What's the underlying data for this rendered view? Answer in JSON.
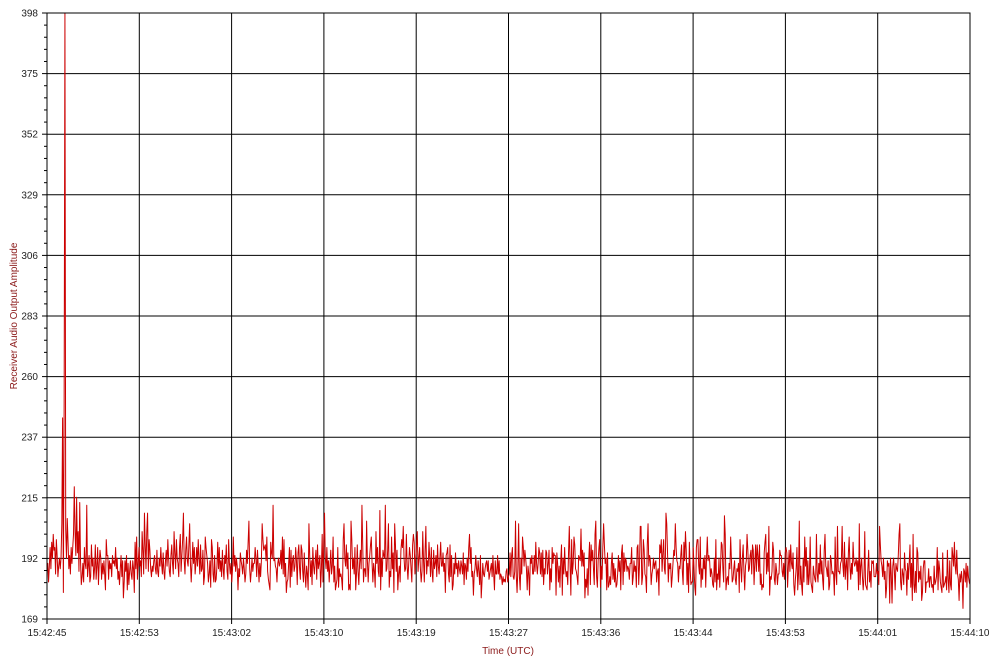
{
  "chart_data": {
    "type": "line",
    "title": "",
    "xlabel": "Time (UTC)",
    "ylabel": "Receiver Audio Output Amplitude",
    "ylim": [
      169,
      398
    ],
    "yticks": [
      398,
      375,
      352,
      329,
      306,
      283,
      260,
      237,
      215,
      192,
      169
    ],
    "xticks": [
      "15:42:45",
      "15:42:53",
      "15:43:02",
      "15:43:10",
      "15:43:19",
      "15:43:27",
      "15:43:36",
      "15:43:44",
      "15:43:53",
      "15:44:01",
      "15:44:10"
    ],
    "grid": true,
    "line_color": "#cc0000",
    "grid_color": "#000000",
    "x_time_start": "15:42:45",
    "x_time_end": "15:44:10",
    "series": [
      {
        "values": [
          187,
          190,
          183,
          189,
          196,
          188,
          198,
          192,
          201,
          195,
          196,
          186,
          199,
          193,
          185,
          189,
          192,
          188,
          192,
          205,
          245,
          179,
          251,
          398,
          203,
          192,
          207,
          198,
          188,
          193,
          186,
          196,
          190,
          196,
          201,
          219,
          202,
          193,
          215,
          194,
          202,
          187,
          213,
          191,
          182,
          185,
          190,
          183,
          196,
          190,
          188,
          212,
          185,
          189,
          193,
          183,
          185,
          197,
          189,
          192,
          184,
          188,
          197,
          184,
          189,
          196,
          182,
          190,
          195,
          192,
          184,
          190,
          186,
          191,
          186,
          180,
          199,
          193,
          193,
          184,
          191,
          188,
          190,
          185,
          193,
          190,
          191,
          189,
          196,
          188,
          192,
          184,
          187,
          182,
          188,
          193,
          185,
          191,
          177,
          183,
          191,
          187,
          193,
          180,
          190,
          182,
          187,
          191,
          186,
          184,
          191,
          188,
          179,
          198,
          188,
          200,
          184,
          190,
          196,
          189,
          191,
          185,
          202,
          195,
          186,
          209,
          197,
          188,
          202,
          209,
          187,
          199,
          195,
          188,
          185,
          189,
          187,
          191,
          193,
          188,
          186,
          195,
          187,
          185,
          192,
          189,
          196,
          190,
          186,
          194,
          187,
          184,
          191,
          195,
          189,
          199,
          192,
          187,
          185,
          193,
          197,
          190,
          186,
          202,
          194,
          188,
          199,
          192,
          190,
          185,
          196,
          201,
          187,
          193,
          199,
          209,
          191,
          186,
          195,
          200,
          191,
          189,
          197,
          205,
          190,
          183,
          190,
          198,
          190,
          196,
          186,
          190,
          196,
          189,
          199,
          192,
          186,
          197,
          187,
          188,
          195,
          182,
          185,
          200,
          196,
          193,
          190,
          183,
          186,
          191,
          181,
          199,
          196,
          186,
          183,
          193,
          183,
          184,
          189,
          198,
          188,
          196,
          187,
          191,
          185,
          195,
          188,
          184,
          193,
          190,
          197,
          187,
          184,
          199,
          190,
          186,
          190,
          183,
          188,
          200,
          189,
          193,
          187,
          192,
          189,
          180,
          188,
          185,
          194,
          191,
          189,
          186,
          192,
          188,
          183,
          186,
          195,
          190,
          198,
          206,
          188,
          183,
          187,
          192,
          187,
          190,
          190,
          196,
          192,
          185,
          195,
          189,
          183,
          190,
          185,
          191,
          205,
          199,
          195,
          196,
          197,
          191,
          200,
          187,
          184,
          182,
          180,
          198,
          194,
          192,
          212,
          191,
          192,
          189,
          188,
          183,
          190,
          192,
          189,
          190,
          195,
          188,
          200,
          186,
          199,
          185,
          190,
          179,
          183,
          184,
          190,
          196,
          181,
          195,
          185,
          191,
          193,
          187,
          189,
          196,
          191,
          182,
          194,
          197,
          188,
          184,
          197,
          195,
          187,
          183,
          194,
          186,
          181,
          189,
          186,
          180,
          205,
          193,
          185,
          191,
          182,
          196,
          189,
          186,
          191,
          195,
          184,
          197,
          188,
          190,
          193,
          181,
          188,
          201,
          183,
          198,
          209,
          192,
          188,
          196,
          187,
          191,
          183,
          189,
          195,
          186,
          189,
          200,
          183,
          189,
          180,
          182,
          184,
          196,
          181,
          188,
          185,
          186,
          184,
          180,
          199,
          205,
          192,
          189,
          197,
          188,
          194,
          180,
          182,
          180,
          206,
          199,
          188,
          192,
          186,
          196,
          180,
          186,
          197,
          187,
          182,
          190,
          195,
          188,
          212,
          197,
          183,
          188,
          188,
          185,
          206,
          191,
          183,
          190,
          193,
          197,
          200,
          190,
          183,
          190,
          187,
          181,
          202,
          190,
          196,
          187,
          185,
          210,
          180,
          192,
          185,
          195,
          193,
          192,
          212,
          187,
          188,
          195,
          205,
          181,
          187,
          185,
          200,
          188,
          194,
          179,
          205,
          197,
          187,
          195,
          180,
          186,
          189,
          183,
          195,
          199,
          196,
          204,
          192,
          187,
          188,
          201,
          189,
          184,
          190,
          196,
          193,
          188,
          183,
          197,
          201,
          198,
          186,
          192,
          197,
          202,
          187,
          192,
          196,
          188,
          183,
          187,
          202,
          191,
          183,
          195,
          204,
          186,
          191,
          189,
          198,
          192,
          185,
          196,
          187,
          183,
          195,
          188,
          190,
          193,
          185,
          197,
          189,
          186,
          192,
          198,
          189,
          189,
          194,
          187,
          190,
          179,
          193,
          194,
          196,
          186,
          183,
          197,
          185,
          193,
          180,
          182,
          190,
          186,
          194,
          188,
          190,
          185,
          191,
          188,
          186,
          191,
          189,
          186,
          194,
          182,
          190,
          189,
          184,
          192,
          187,
          196,
          201,
          190,
          196,
          185,
          187,
          178,
          186,
          188,
          193,
          188,
          185,
          191,
          187,
          182,
          193,
          177,
          183,
          190,
          186,
          185,
          188,
          190,
          191,
          187,
          191,
          184,
          186,
          188,
          190,
          185,
          193,
          186,
          180,
          191,
          186,
          186,
          193,
          186,
          191,
          184,
          186,
          185,
          182,
          185,
          183,
          184,
          183,
          187,
          188,
          183,
          185,
          186,
          194,
          185,
          193,
          196,
          185,
          184,
          187,
          206,
          185,
          179,
          188,
          205,
          185,
          180,
          192,
          186,
          200,
          196,
          189,
          195,
          192,
          188,
          180,
          189,
          186,
          178,
          192,
          190,
          193,
          186,
          186,
          193,
          187,
          198,
          190,
          186,
          190,
          196,
          194,
          186,
          194,
          185,
          195,
          182,
          188,
          186,
          195,
          194,
          186,
          190,
          195,
          180,
          188,
          183,
          196,
          190,
          194,
          193,
          193,
          178,
          194,
          190,
          183,
          189,
          181,
          191,
          197,
          178,
          192,
          186,
          196,
          188,
          185,
          187,
          182,
          194,
          204,
          189,
          178,
          199,
          186,
          190,
          200,
          197,
          188,
          187,
          185,
          182,
          193,
          192,
          191,
          203,
          189,
          195,
          189,
          194,
          177,
          184,
          181,
          188,
          178,
          192,
          198,
          182,
          197,
          191,
          195,
          188,
          182,
          201,
          206,
          185,
          181,
          191,
          196,
          199,
          181,
          189,
          184,
          196,
          205,
          197,
          190,
          192,
          180,
          194,
          181,
          182,
          185,
          182,
          190,
          194,
          184,
          190,
          183,
          188,
          181,
          182,
          186,
          193,
          187,
          191,
          180,
          194,
          197,
          182,
          194,
          187,
          192,
          191,
          187,
          189,
          188,
          184,
          190,
          190,
          196,
          182,
          185,
          191,
          187,
          189,
          181,
          196,
          197,
          182,
          189,
          204,
          204,
          182,
          185,
          199,
          195,
          186,
          185,
          179,
          197,
          205,
          189,
          193,
          191,
          182,
          186,
          188,
          192,
          188,
          190,
          191,
          183,
          187,
          188,
          178,
          197,
          194,
          199,
          187,
          194,
          199,
          188,
          186,
          209,
          205,
          194,
          183,
          190,
          188,
          190,
          181,
          185,
          190,
          195,
          193,
          205,
          196,
          191,
          190,
          183,
          189,
          188,
          193,
          197,
          187,
          182,
          198,
          191,
          202,
          195,
          182,
          190,
          179,
          198,
          188,
          182,
          183,
          183,
          196,
          188,
          181,
          178,
          196,
          199,
          199,
          189,
          186,
          200,
          181,
          188,
          184,
          192,
          188,
          193,
          181,
          192,
          200,
          191,
          193,
          191,
          185,
          188,
          186,
          182,
          181,
          192,
          183,
          199,
          180,
          186,
          184,
          192,
          181,
          189,
          198,
          197,
          188,
          183,
          208,
          201,
          180,
          184,
          185,
          182,
          190,
          188,
          200,
          191,
          183,
          184,
          188,
          191,
          184,
          182,
          188,
          187,
          190,
          179,
          199,
          189,
          183,
          192,
          197,
          187,
          180,
          189,
          191,
          201,
          195,
          187,
          188,
          193,
          195,
          186,
          197,
          195,
          182,
          190,
          197,
          187,
          197,
          193,
          187,
          197,
          182,
          186,
          180,
          182,
          181,
          194,
          198,
          201,
          186,
          194,
          187,
          204,
          178,
          185,
          184,
          187,
          198,
          195,
          184,
          182,
          190,
          187,
          182,
          186,
          186,
          195,
          193,
          193,
          187,
          185,
          190,
          184,
          194,
          196,
          194,
          181,
          189,
          195,
          187,
          197,
          190,
          188,
          194,
          182,
          178,
          184,
          188,
          196,
          180,
          186,
          206,
          182,
          189,
          182,
          178,
          192,
          183,
          200,
          189,
          196,
          182,
          191,
          182,
          186,
          200,
          183,
          181,
          179,
          189,
          186,
          184,
          183,
          201,
          186,
          183,
          190,
          186,
          197,
          186,
          191,
          184,
          180,
          195,
          201,
          189,
          188,
          185,
          191,
          180,
          182,
          193,
          191,
          186,
          187,
          186,
          178,
          200,
          186,
          182,
          204,
          187,
          187,
          186,
          190,
          191,
          204,
          189,
          185,
          198,
          184,
          189,
          192,
          180,
          194,
          200,
          189,
          184,
          190,
          186,
          198,
          191,
          189,
          190,
          192,
          187,
          191,
          180,
          205,
          182,
          189,
          192,
          185,
          180,
          185,
          202,
          182,
          181,
          180,
          188,
          195,
          183,
          187,
          181,
          191,
          190,
          191,
          185,
          185,
          185,
          190,
          186,
          187,
          182,
          204,
          197,
          191,
          189,
          185,
          192,
          184,
          187,
          177,
          181,
          191,
          189,
          190,
          175,
          192,
          186,
          175,
          189,
          192,
          187,
          180,
          190,
          188,
          187,
          193,
          201,
          205,
          183,
          180,
          188,
          186,
          182,
          194,
          188,
          187,
          178,
          190,
          184,
          190,
          197,
          181,
          190,
          176,
          201,
          182,
          179,
          187,
          179,
          196,
          194,
          183,
          187,
          184,
          189,
          176,
          179,
          188,
          191,
          191,
          179,
          183,
          183,
          183,
          188,
          181,
          185,
          185,
          181,
          182,
          179,
          189,
          182,
          183,
          185,
          196,
          180,
          191,
          188,
          183,
          181,
          179,
          194,
          181,
          182,
          183,
          185,
          180,
          195,
          184,
          179,
          191,
          182,
          180,
          196,
          193,
          189,
          198,
          189,
          186,
          195,
          186,
          184,
          176,
          186,
          183,
          187,
          184,
          173,
          188,
          187,
          183,
          190,
          181,
          189,
          185,
          183,
          182
        ]
      }
    ]
  }
}
